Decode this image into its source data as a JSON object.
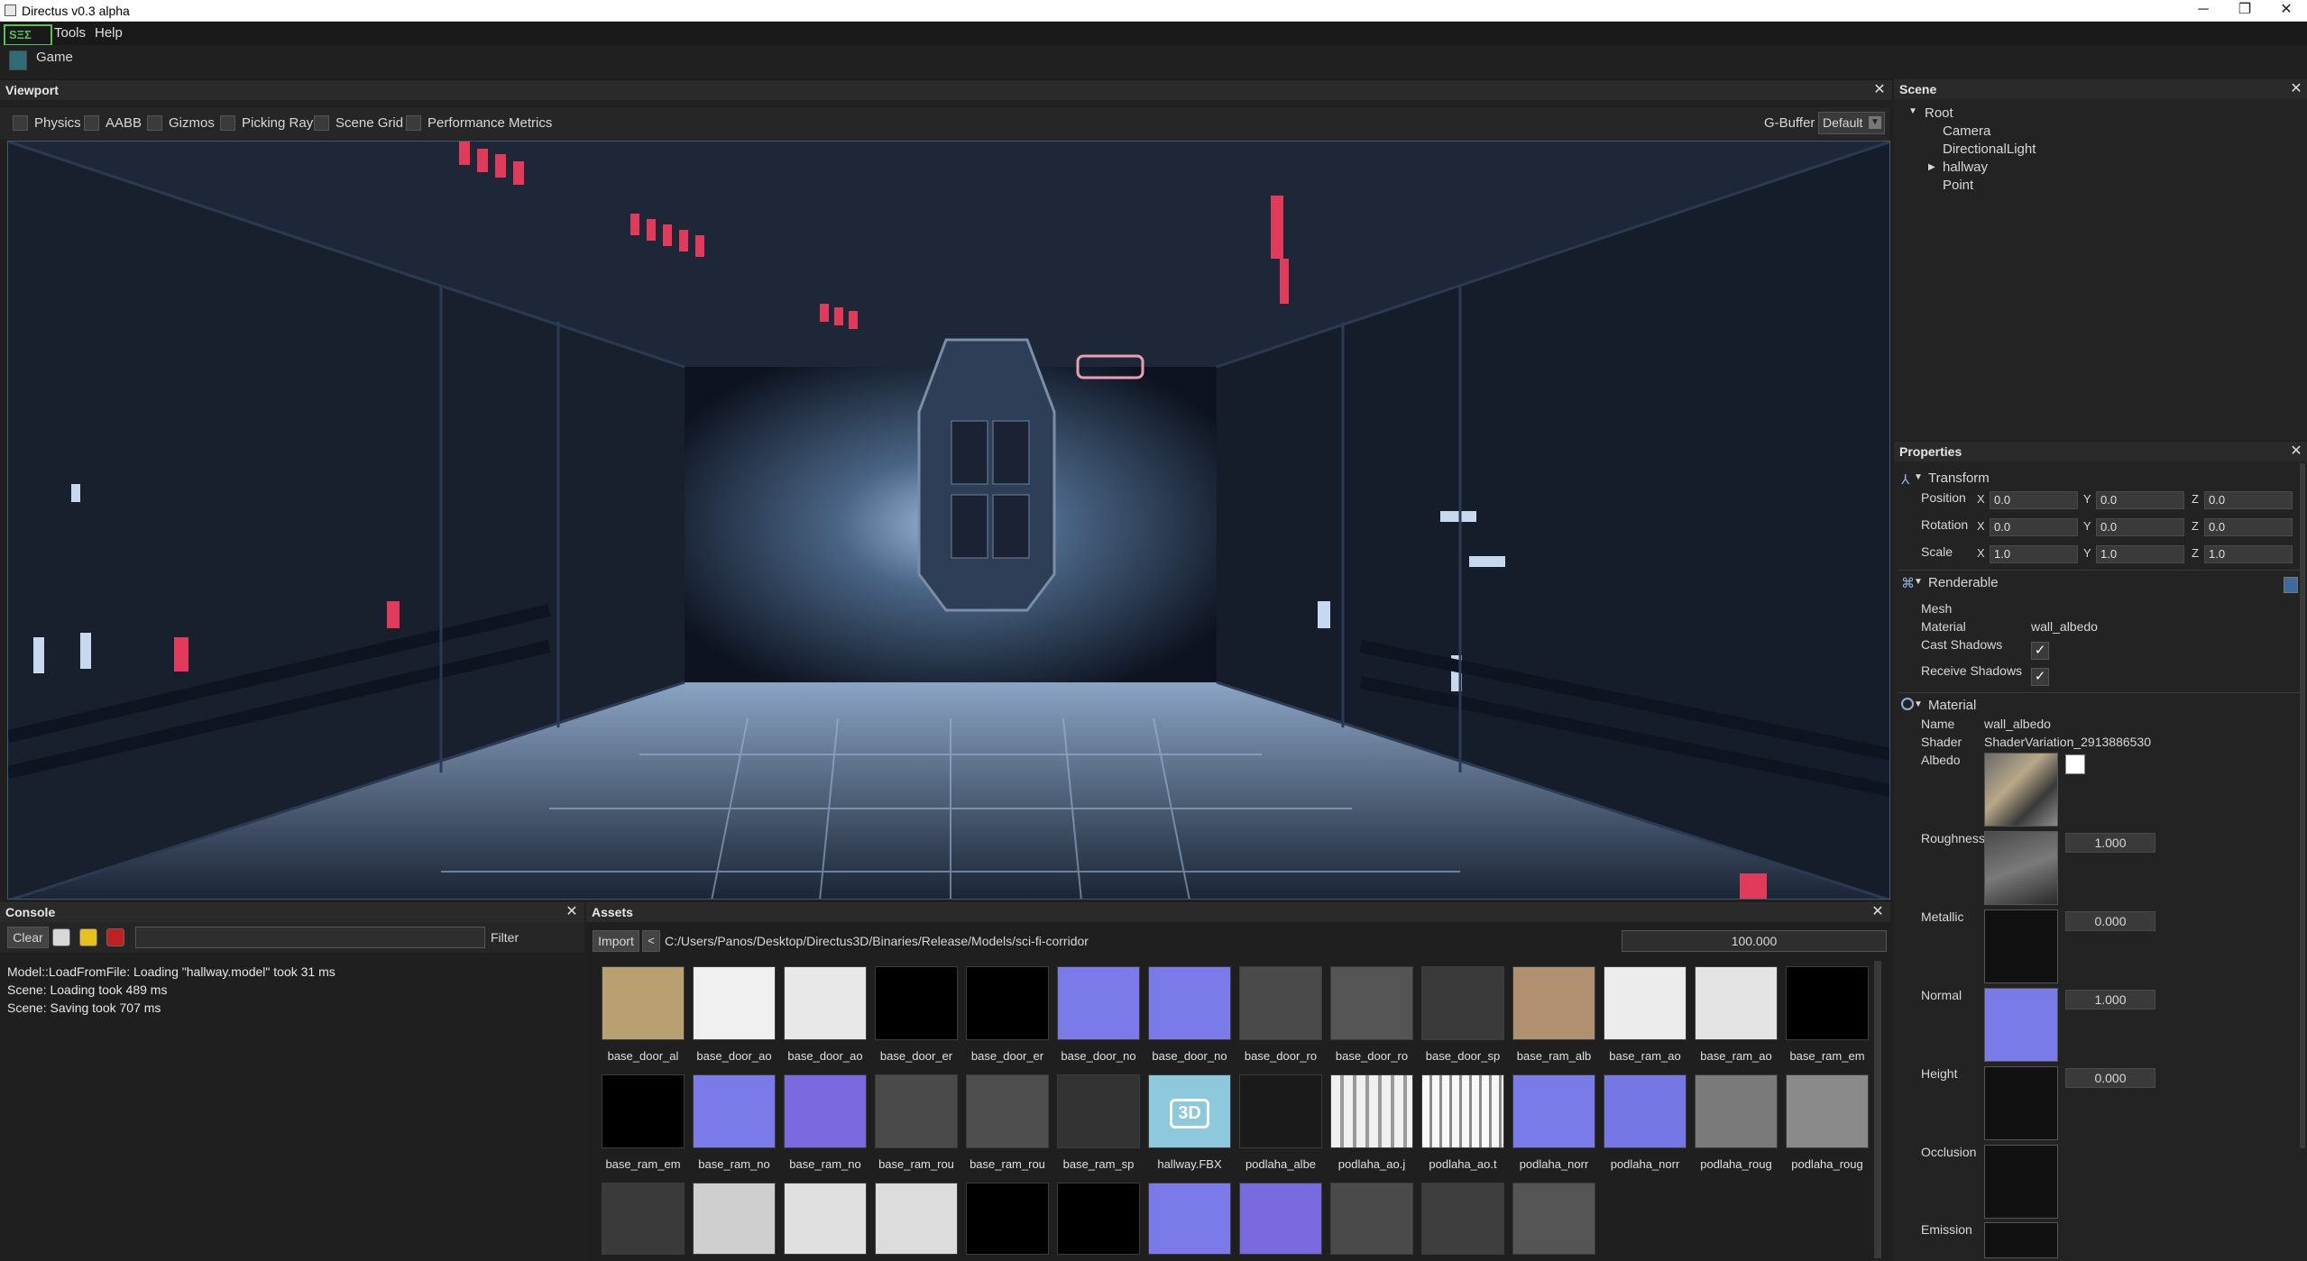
{
  "window": {
    "title": "Directus v0.3 alpha",
    "minimize": "─",
    "maximize": "❐",
    "close": "✕"
  },
  "menu": {
    "logo": "SΞΣ",
    "items": [
      "Tools",
      "Help"
    ]
  },
  "tabs": {
    "game": "Game"
  },
  "viewport": {
    "title": "Viewport",
    "toggles": [
      "Physics",
      "AABB",
      "Gizmos",
      "Picking Ray",
      "Scene Grid",
      "Performance Metrics"
    ],
    "gbuffer_label": "G-Buffer",
    "gbuffer_value": "Default"
  },
  "scene": {
    "title": "Scene",
    "root": "Root",
    "children": [
      "Camera",
      "DirectionalLight",
      "hallway",
      "Point"
    ]
  },
  "properties": {
    "title": "Properties",
    "transform": {
      "title": "Transform",
      "rows": [
        {
          "label": "Position",
          "x": "0.0",
          "y": "0.0",
          "z": "0.0"
        },
        {
          "label": "Rotation",
          "x": "0.0",
          "y": "0.0",
          "z": "0.0"
        },
        {
          "label": "Scale",
          "x": "1.0",
          "y": "1.0",
          "z": "1.0"
        }
      ]
    },
    "renderable": {
      "title": "Renderable",
      "mesh_label": "Mesh",
      "material_label": "Material",
      "material_value": "wall_albedo",
      "cast_shadows_label": "Cast Shadows",
      "receive_shadows_label": "Receive Shadows"
    },
    "material": {
      "title": "Material",
      "name_label": "Name",
      "name_value": "wall_albedo",
      "shader_label": "Shader",
      "shader_value": "ShaderVariation_2913886530",
      "albedo_label": "Albedo",
      "roughness_label": "Roughness",
      "roughness_value": "1.000",
      "metallic_label": "Metallic",
      "metallic_value": "0.000",
      "normal_label": "Normal",
      "normal_value": "1.000",
      "height_label": "Height",
      "height_value": "0.000",
      "occlusion_label": "Occlusion",
      "emission_label": "Emission"
    }
  },
  "console": {
    "title": "Console",
    "clear": "Clear",
    "filter": "Filter",
    "lines": [
      "Model::LoadFromFile: Loading \"hallway.model\" took 31 ms",
      "Scene: Loading took 489 ms",
      "Scene: Saving took 707 ms"
    ]
  },
  "assets": {
    "title": "Assets",
    "import": "Import",
    "back": "<",
    "path": "C:/Users/Panos/Desktop/Directus3D/Binaries/Release/Models/sci-fi-corridor",
    "zoom": "100.000",
    "row1": [
      "base_door_al",
      "base_door_ao",
      "base_door_ao",
      "base_door_er",
      "base_door_er",
      "base_door_no",
      "base_door_no",
      "base_door_ro",
      "base_door_ro",
      "base_door_sp",
      "base_ram_alb",
      "base_ram_ao",
      "base_ram_ao",
      "base_ram_em"
    ],
    "row2": [
      "base_ram_em",
      "base_ram_no",
      "base_ram_no",
      "base_ram_rou",
      "base_ram_rou",
      "base_ram_sp",
      "hallway.FBX",
      "podlaha_albe",
      "podlaha_ao.j",
      "podlaha_ao.t",
      "podlaha_norr",
      "podlaha_norr",
      "podlaha_roug",
      "podlaha_roug"
    ],
    "fbx_badge": "3D"
  },
  "colors": {
    "accent": "#5ac05a",
    "normal_map": "#7a7ae8",
    "panel": "#232323"
  }
}
